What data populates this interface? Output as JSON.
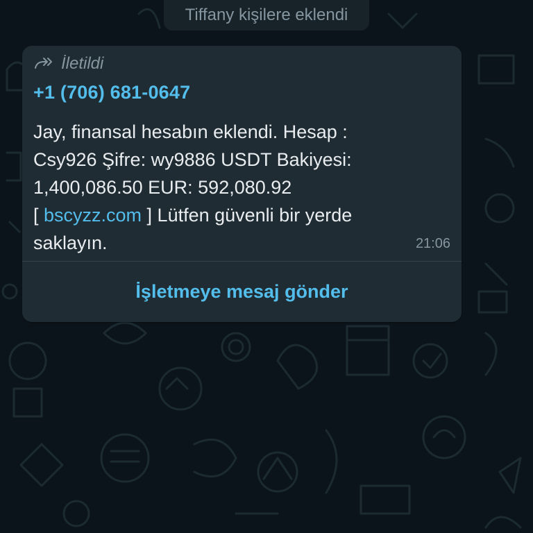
{
  "system_notice": "Tiffany kişilere eklendi",
  "message": {
    "forwarded_label": "İletildi",
    "forward_icon": "forward-arrows-icon",
    "sender": "+1 (706) 681-0647",
    "lines": [
      "Jay, finansal hesabın eklendi. Hesap :",
      "Csy926 Şifre: wy9886 USDT Bakiyesi:",
      "1,400,086.50 EUR: 592,080.92"
    ],
    "link_prefix": "[ ",
    "link_text": "bscyzz.com",
    "link_suffix": " ] Lütfen güvenli bir yerde",
    "last_line": "saklayın.",
    "time": "21:06",
    "action_label": "İşletmeye mesaj gönder"
  },
  "colors": {
    "background": "#0b141a",
    "bubble": "#202c33",
    "accent": "#53bdeb",
    "text": "#e9edef",
    "meta": "#8696a0"
  }
}
